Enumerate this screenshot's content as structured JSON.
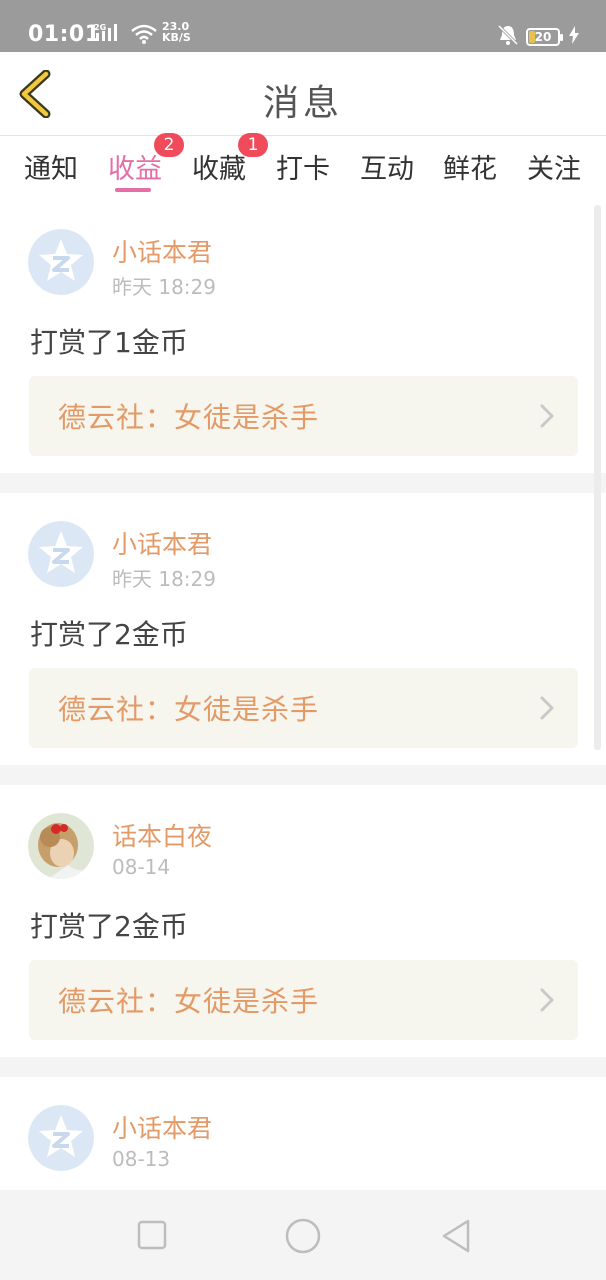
{
  "status_bar": {
    "time": "01:01",
    "network": "2G",
    "speed_value": "23.0",
    "speed_unit": "KB/S",
    "battery": "20"
  },
  "header": {
    "title": "消息",
    "back_icon": "chevron-left-icon"
  },
  "tabs": [
    {
      "label": "通知",
      "badge": "",
      "active": false
    },
    {
      "label": "收益",
      "badge": "2",
      "active": true
    },
    {
      "label": "收藏",
      "badge": "1",
      "active": false
    },
    {
      "label": "打卡",
      "badge": "",
      "active": false
    },
    {
      "label": "互动",
      "badge": "",
      "active": false
    },
    {
      "label": "鲜花",
      "badge": "",
      "active": false
    },
    {
      "label": "关注",
      "badge": "",
      "active": false
    }
  ],
  "colors": {
    "accent": "#e36fa6",
    "username": "#e39a67",
    "badge": "#f04b5a",
    "book_bg": "#f6f5ee"
  },
  "messages": [
    {
      "user": "小话本君",
      "time": "昨天 18:29",
      "text": "打赏了1金币",
      "book": "德云社：女徒是杀手",
      "avatar": "default-avatar"
    },
    {
      "user": "小话本君",
      "time": "昨天 18:29",
      "text": "打赏了2金币",
      "book": "德云社：女徒是杀手",
      "avatar": "default-avatar"
    },
    {
      "user": "话本白夜",
      "time": "08-14",
      "text": "打赏了2金币",
      "book": "德云社：女徒是杀手",
      "avatar": "photo-avatar"
    },
    {
      "user": "小话本君",
      "time": "08-13",
      "text": "",
      "book": "",
      "avatar": "default-avatar"
    }
  ]
}
